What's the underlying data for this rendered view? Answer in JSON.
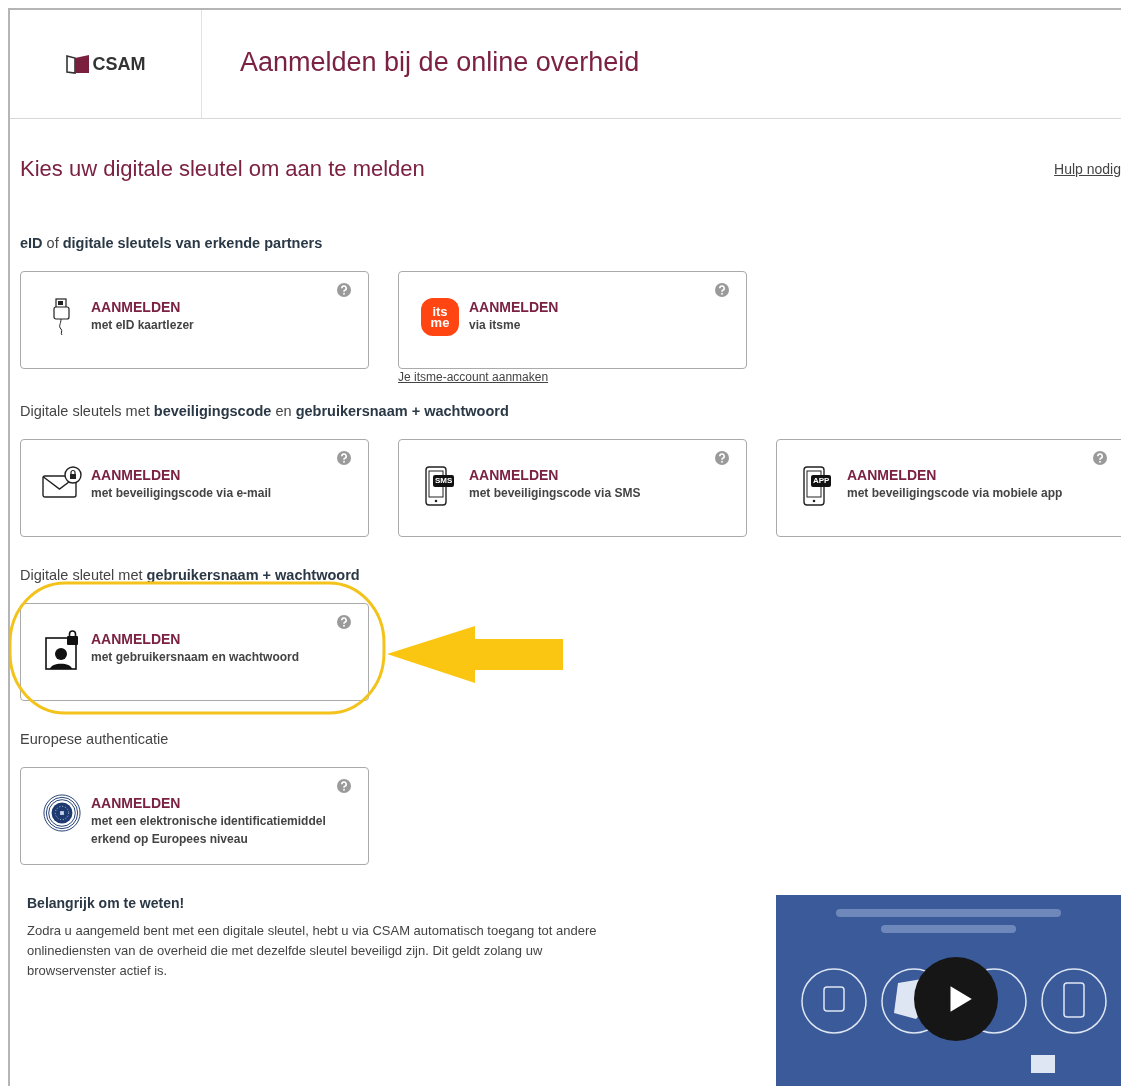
{
  "header": {
    "logo_text": "CSAM",
    "title": "Aanmelden bij de online overheid"
  },
  "heading": "Kies uw digitale sleutel om aan te melden",
  "help_link": "Hulp nodig",
  "sections": [
    {
      "heading": "**eID** of **digitale sleutels van erkende partners**",
      "cards": [
        {
          "kind": "card-reader",
          "action": "AANMELDEN",
          "subtitle": "met eID kaartlezer",
          "highlighted": false
        },
        {
          "kind": "itsme",
          "logo_lines": [
            "its",
            "me"
          ],
          "action": "AANMELDEN",
          "subtitle": "via itsme",
          "link": "Je itsme-account aanmaken",
          "highlighted": false
        }
      ]
    },
    {
      "heading": "Digitale sleutels met **beveiligingscode** en **gebruikersnaam + wachtwoord**",
      "cards": [
        {
          "kind": "email",
          "action": "AANMELDEN",
          "subtitle": "met beveiligingscode via e-mail",
          "highlighted": false
        },
        {
          "kind": "phone",
          "icon_label": "SMS",
          "action": "AANMELDEN",
          "subtitle": "met beveiligingscode via SMS",
          "highlighted": false
        },
        {
          "kind": "phone",
          "icon_label": "APP",
          "action": "AANMELDEN",
          "subtitle": "met beveiligingscode via mobiele app",
          "highlighted": false
        }
      ]
    },
    {
      "heading": "Digitale sleutel met **gebruikersnaam + wachtwoord**",
      "cards": [
        {
          "kind": "user-lock",
          "action": "AANMELDEN",
          "subtitle": "met gebruikersnaam en wachtwoord",
          "highlighted": true
        }
      ]
    },
    {
      "heading": "Europese authenticatie",
      "cards": [
        {
          "kind": "eu-seal",
          "action": "AANMELDEN",
          "subtitle": "met een elektronische identificatiemiddel erkend op Europees niveau",
          "highlighted": false
        }
      ]
    }
  ],
  "notice": {
    "title": "Belangrijk om te weten!",
    "text": "Zodra u aangemeld bent met een digitale sleutel, hebt u via CSAM automatisch toegang tot andere onlinediensten van de overheid die met dezelfde sleutel beveiligd zijn. Dit geldt zolang uw browservenster actief is."
  }
}
